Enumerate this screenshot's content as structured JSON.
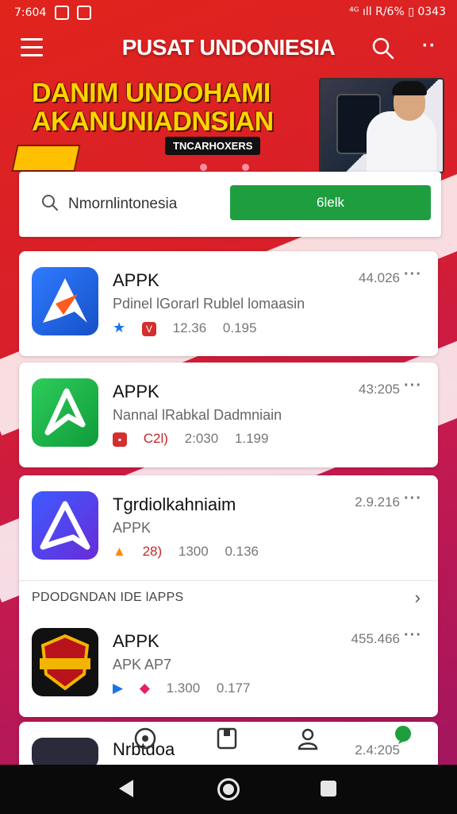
{
  "status_bar": {
    "time": "7:604",
    "right": "⁴ᴳ ıll R/6% ▯ 0343"
  },
  "app_bar": {
    "title": "PUSAT UNDONIESIA"
  },
  "banner": {
    "headline_1": "DANIM UNDOHAMI",
    "headline_2": "AKANUNIADNSIAN",
    "tag": "TNCARHOXERS"
  },
  "search": {
    "value": "Nmornlintonesia",
    "button_label": "6lelk"
  },
  "apps_top": [
    {
      "name": "APPK",
      "subtitle": "Pdinel lGorarl Rublel lomaasin",
      "badge": "",
      "meta_1": "12.36",
      "meta_2": "0.195",
      "size": "44.026"
    },
    {
      "name": "APPK",
      "subtitle": "Nannal lRabkal Dadmniain",
      "badge": "C2l)",
      "meta_1": "2:030",
      "meta_2": "1.199",
      "size": "43:205"
    },
    {
      "name": "Tgrdiolkahniaim",
      "subtitle": "APPK",
      "badge": "28)",
      "meta_1": "1300",
      "meta_2": "0.136",
      "size": "2.9.216"
    }
  ],
  "section": {
    "title": "PDODGNDAN IDE lAPPS"
  },
  "apps_section": [
    {
      "name": "APPK",
      "subtitle": "APK AP7",
      "meta_1": "1.300",
      "meta_2": "0.177",
      "size": "455.466"
    }
  ],
  "partial_app": {
    "name": "Nrbtdoa",
    "size": "2.4:205"
  },
  "colors": {
    "accent_red": "#d81f2a",
    "button_green": "#1e9e3e"
  },
  "icons": [
    "hamburger-menu-icon",
    "search-icon",
    "more-vert-icon",
    "star-icon",
    "back-icon",
    "home-icon",
    "recent-apps-icon"
  ]
}
